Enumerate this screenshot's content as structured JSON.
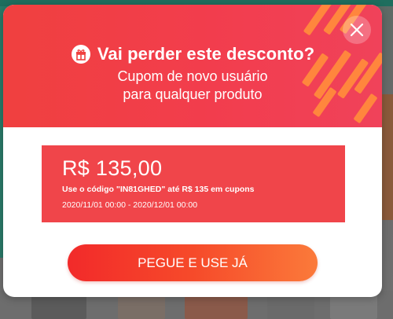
{
  "modal": {
    "title": "Vai perder este desconto?",
    "subtitle_line1": "Cupom de novo usuário",
    "subtitle_line2": "para qualquer produto",
    "close_icon": "close-icon",
    "gift_icon": "gift-icon"
  },
  "coupon": {
    "amount": "R$ 135,00",
    "code_text": "Use o código \"IN81GHED\" até R$ 135 em cupons",
    "validity": "2020/11/01 00:00 - 2020/12/01 00:00"
  },
  "cta": {
    "label": "PEGUE E USE JÁ"
  },
  "colors": {
    "header_red": "#f0403f",
    "coupon_red": "#f0454a",
    "stripe_orange": "#ff8a3c",
    "cta_start": "#f22a2a",
    "cta_end": "#fb7a3a"
  }
}
